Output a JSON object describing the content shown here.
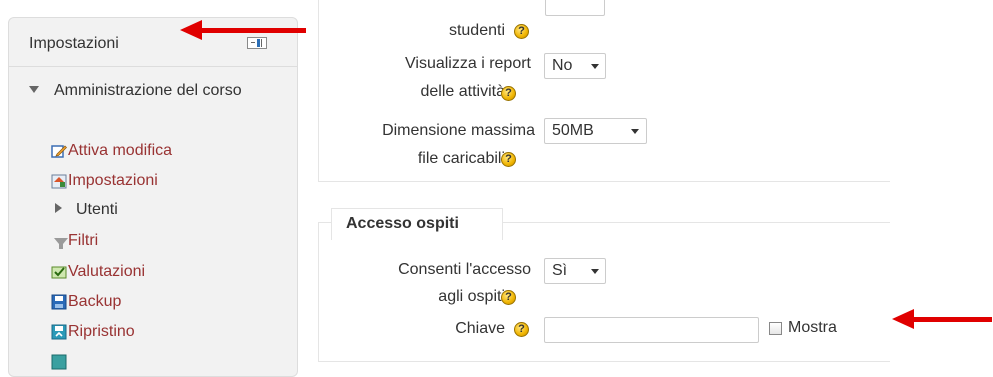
{
  "block": {
    "title": "Impostazioni",
    "section_label": "Amministrazione del corso",
    "items": [
      {
        "label": "Attiva modifica",
        "icon": "edit-icon"
      },
      {
        "label": "Impostazioni",
        "icon": "settings-icon"
      },
      {
        "label": "Utenti",
        "icon": "collapsed-arrow-icon"
      },
      {
        "label": "Filtri",
        "icon": "filter-icon"
      },
      {
        "label": "Valutazioni",
        "icon": "grades-icon"
      },
      {
        "label": "Backup",
        "icon": "backup-icon"
      },
      {
        "label": "Ripristino",
        "icon": "restore-icon"
      }
    ]
  },
  "form": {
    "top_partial_label": "studenti",
    "activity_reports": {
      "label_line1": "Visualizza i report",
      "label_line2": "delle attività",
      "value": "No"
    },
    "max_upload": {
      "label_line1": "Dimensione massima",
      "label_line2": "file caricabili",
      "value": "50MB"
    },
    "guest_section": {
      "legend": "Accesso ospiti",
      "allow_guest": {
        "label_line1": "Consenti l'accesso",
        "label_line2": "agli ospiti",
        "value": "Sì"
      },
      "key": {
        "label": "Chiave",
        "value": "",
        "show_label": "Mostra"
      }
    },
    "help_glyph": "?"
  },
  "colors": {
    "arrow": "#e00000",
    "link": "#993333",
    "block_bg": "#f2f2f2",
    "help_icon": "#f0b400"
  }
}
